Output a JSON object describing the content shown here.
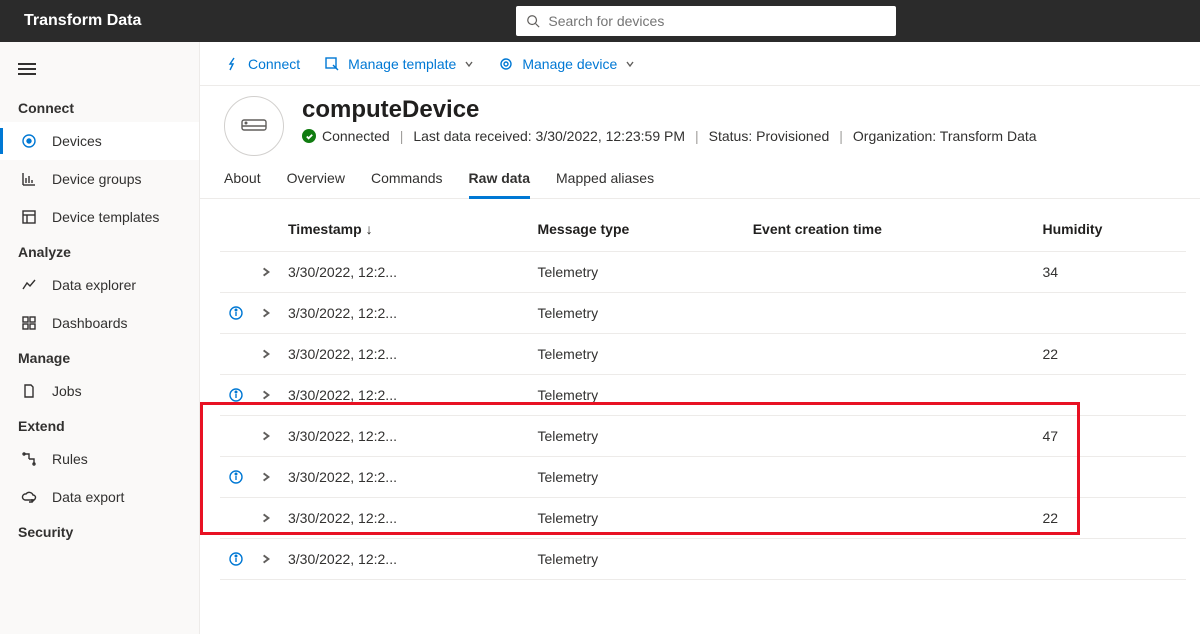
{
  "app": {
    "title": "Transform Data"
  },
  "search": {
    "placeholder": "Search for devices"
  },
  "sidebar": {
    "sections": {
      "connect": "Connect",
      "analyze": "Analyze",
      "manage": "Manage",
      "extend": "Extend",
      "security": "Security"
    },
    "items": {
      "devices": "Devices",
      "device_groups": "Device groups",
      "device_templates": "Device templates",
      "data_explorer": "Data explorer",
      "dashboards": "Dashboards",
      "jobs": "Jobs",
      "rules": "Rules",
      "data_export": "Data export"
    }
  },
  "cmdbar": {
    "connect": "Connect",
    "manage_template": "Manage template",
    "manage_device": "Manage device"
  },
  "device": {
    "name": "computeDevice",
    "status_label": "Connected",
    "last_data_label": "Last data received: 3/30/2022, 12:23:59 PM",
    "status_field": "Status: Provisioned",
    "org_field": "Organization: Transform Data"
  },
  "tabs": {
    "about": "About",
    "overview": "Overview",
    "commands": "Commands",
    "raw_data": "Raw data",
    "mapped_aliases": "Mapped aliases"
  },
  "table": {
    "headers": {
      "timestamp": "Timestamp",
      "message_type": "Message type",
      "event_creation_time": "Event creation time",
      "humidity": "Humidity"
    },
    "rows": [
      {
        "info": false,
        "timestamp": "3/30/2022, 12:2...",
        "message_type": "Telemetry",
        "event_creation_time": "",
        "humidity": "34"
      },
      {
        "info": true,
        "timestamp": "3/30/2022, 12:2...",
        "message_type": "Telemetry",
        "event_creation_time": "",
        "humidity": ""
      },
      {
        "info": false,
        "timestamp": "3/30/2022, 12:2...",
        "message_type": "Telemetry",
        "event_creation_time": "",
        "humidity": "22"
      },
      {
        "info": true,
        "timestamp": "3/30/2022, 12:2...",
        "message_type": "Telemetry",
        "event_creation_time": "",
        "humidity": ""
      },
      {
        "info": false,
        "timestamp": "3/30/2022, 12:2...",
        "message_type": "Telemetry",
        "event_creation_time": "",
        "humidity": "47"
      },
      {
        "info": true,
        "timestamp": "3/30/2022, 12:2...",
        "message_type": "Telemetry",
        "event_creation_time": "",
        "humidity": ""
      },
      {
        "info": false,
        "timestamp": "3/30/2022, 12:2...",
        "message_type": "Telemetry",
        "event_creation_time": "",
        "humidity": "22"
      },
      {
        "info": true,
        "timestamp": "3/30/2022, 12:2...",
        "message_type": "Telemetry",
        "event_creation_time": "",
        "humidity": ""
      }
    ]
  }
}
